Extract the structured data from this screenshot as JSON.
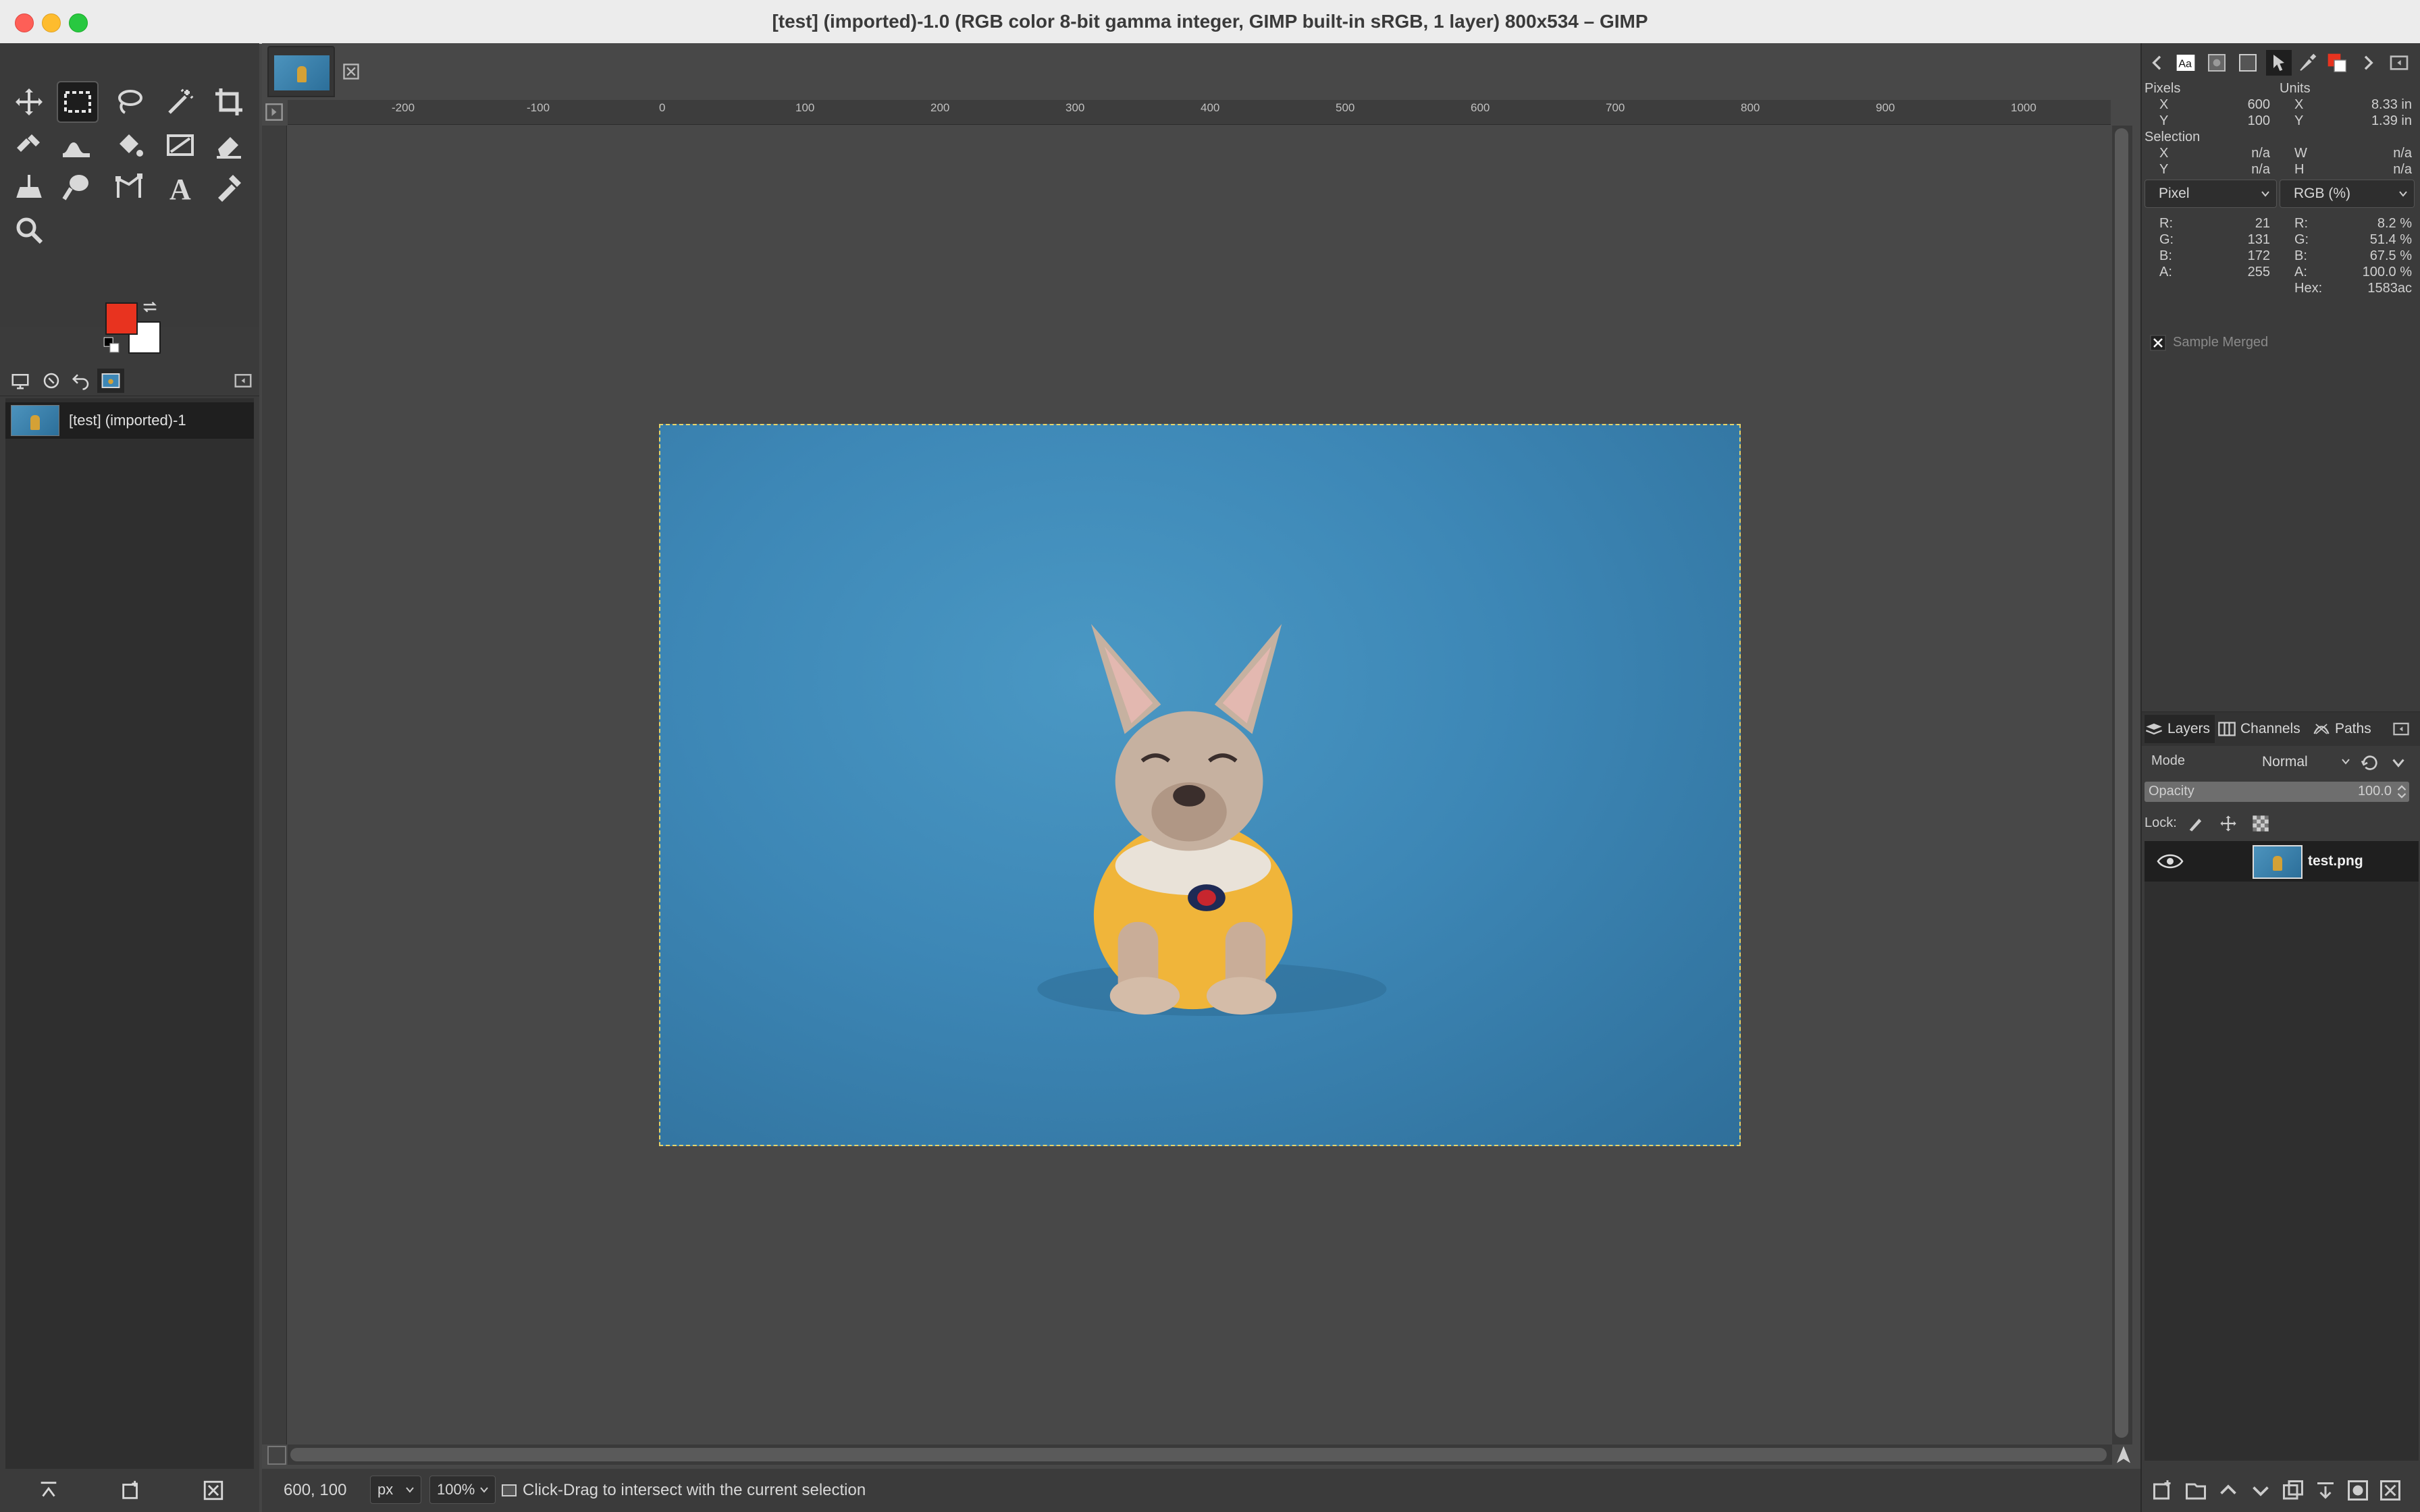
{
  "window": {
    "title": "[test] (imported)-1.0 (RGB color 8-bit gamma integer, GIMP built-in sRGB, 1 layer) 800x534 – GIMP"
  },
  "toolbox": {
    "tools": [
      "move-tool",
      "rect-select-tool",
      "lasso-tool",
      "fuzzy-select-tool",
      "crop-tool",
      "warp-transform-tool",
      "smudge-tool",
      "bucket-fill-tool",
      "gradient-tool",
      "eraser-tool",
      "clone-tool",
      "dodge-burn-tool",
      "paths-tool",
      "text-tool",
      "color-picker-tool",
      "zoom-tool"
    ],
    "active_tool": "rect-select-tool",
    "fg_color": "#e8331f",
    "bg_color": "#ffffff"
  },
  "images_panel": {
    "items": [
      {
        "label": "[test] (imported)-1"
      }
    ]
  },
  "canvas": {
    "ruler_ticks": [
      "-200",
      "-100",
      "0",
      "100",
      "200",
      "300",
      "400",
      "500",
      "600",
      "700",
      "800",
      "900",
      "1000"
    ]
  },
  "statusbar": {
    "coords": "600, 100",
    "unit": "px",
    "zoom": "100%",
    "message": "Click-Drag to intersect with the current selection"
  },
  "pointer": {
    "pixels_label": "Pixels",
    "units_label": "Units",
    "x_label": "X",
    "y_label": "Y",
    "px_x": "600",
    "px_y": "100",
    "unit_x": "8.33 in",
    "unit_y": "1.39 in",
    "selection_label": "Selection",
    "w_label": "W",
    "h_label": "H",
    "sel_x": "n/a",
    "sel_y": "n/a",
    "sel_w": "n/a",
    "sel_h": "n/a",
    "left_mode": "Pixel",
    "right_mode": "RGB (%)",
    "r_label": "R:",
    "g_label": "G:",
    "b_label": "B:",
    "a_label": "A:",
    "hex_label": "Hex:",
    "r": "21",
    "g": "131",
    "b": "172",
    "a": "255",
    "r_pct": "8.2 %",
    "g_pct": "51.4 %",
    "b_pct": "67.5 %",
    "a_pct": "100.0 %",
    "hex": "1583ac",
    "sample_merged": "Sample Merged"
  },
  "layers_panel": {
    "tabs": [
      "Layers",
      "Channels",
      "Paths"
    ],
    "mode_label": "Mode",
    "mode_value": "Normal",
    "opacity_label": "Opacity",
    "opacity_value": "100.0",
    "lock_label": "Lock:",
    "layers": [
      {
        "name": "test.png",
        "visible": true
      }
    ]
  }
}
